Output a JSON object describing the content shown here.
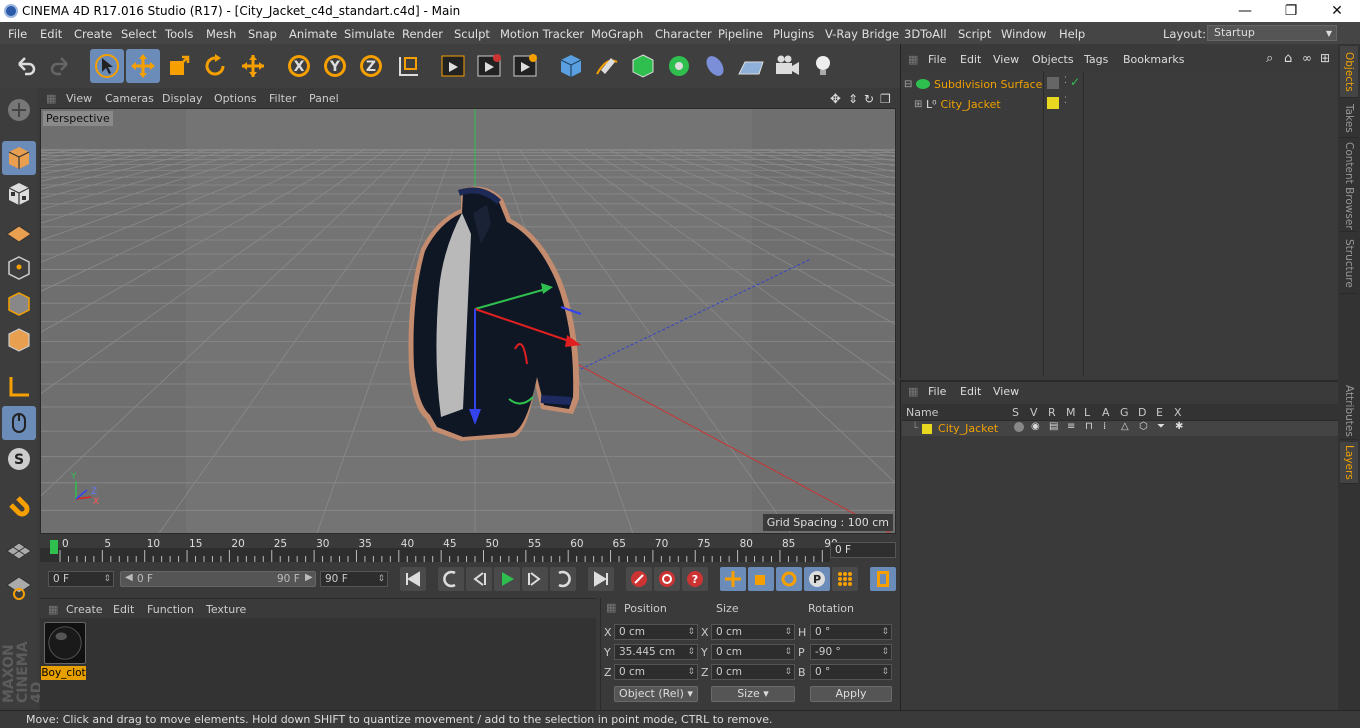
{
  "window": {
    "title": "CINEMA 4D R17.016 Studio (R17) - [City_Jacket_c4d_standart.c4d] - Main",
    "minimize": "—",
    "maximize": "❐",
    "close": "✕"
  },
  "menubar": {
    "items": [
      "File",
      "Edit",
      "Create",
      "Select",
      "Tools",
      "Mesh",
      "Snap",
      "Animate",
      "Simulate",
      "Render",
      "Sculpt",
      "Motion Tracker",
      "MoGraph",
      "Character",
      "Pipeline",
      "Plugins",
      "V-Ray Bridge",
      "3DToAll",
      "Script",
      "Window",
      "Help"
    ],
    "layout_label": "Layout:",
    "layout_value": "Startup"
  },
  "viewport": {
    "menu": [
      "View",
      "Cameras",
      "Display",
      "Options",
      "Filter",
      "Panel"
    ],
    "label": "Perspective",
    "grid_spacing": "Grid Spacing : 100 cm",
    "axis_y": "Y",
    "axis_z": "Z",
    "axis_x": "X"
  },
  "timeline": {
    "ticks": [
      "0",
      "5",
      "10",
      "15",
      "20",
      "25",
      "30",
      "35",
      "40",
      "45",
      "50",
      "55",
      "60",
      "65",
      "70",
      "75",
      "80",
      "85",
      "90"
    ],
    "current_frame": "0 F"
  },
  "playback": {
    "start": "0 F",
    "range_start": "0 F",
    "range_end": "90 F",
    "end": "90 F"
  },
  "material": {
    "menu": [
      "Create",
      "Edit",
      "Function",
      "Texture"
    ],
    "name": "Boy_clot"
  },
  "coords": {
    "headers": [
      "Position",
      "Size",
      "Rotation"
    ],
    "rows": [
      {
        "axis": "X",
        "pos": "0 cm",
        "size_axis": "X",
        "size": "0 cm",
        "rot_axis": "H",
        "rot": "0 °"
      },
      {
        "axis": "Y",
        "pos": "35.445 cm",
        "size_axis": "Y",
        "size": "0 cm",
        "rot_axis": "P",
        "rot": "-90 °"
      },
      {
        "axis": "Z",
        "pos": "0 cm",
        "size_axis": "Z",
        "size": "0 cm",
        "rot_axis": "B",
        "rot": "0 °"
      }
    ],
    "mode": "Object (Rel)",
    "size_mode": "Size",
    "apply": "Apply"
  },
  "objects": {
    "menu": [
      "File",
      "Edit",
      "View",
      "Objects",
      "Tags",
      "Bookmarks"
    ],
    "items": [
      {
        "name": "Subdivision Surface"
      },
      {
        "name": "City_Jacket"
      }
    ]
  },
  "layers": {
    "menu": [
      "File",
      "Edit",
      "View"
    ],
    "header_name": "Name",
    "columns": [
      "S",
      "V",
      "R",
      "M",
      "L",
      "A",
      "G",
      "D",
      "E",
      "X"
    ],
    "items": [
      {
        "name": "City_Jacket"
      }
    ]
  },
  "right_tabs": [
    "Objects",
    "Takes",
    "Content Browser",
    "Structure",
    "Attributes",
    "Layers"
  ],
  "maxon": "MAXON CINEMA 4D",
  "status": "Move: Click and drag to move elements. Hold down SHIFT to quantize movement / add to the selection in point mode, CTRL to remove."
}
